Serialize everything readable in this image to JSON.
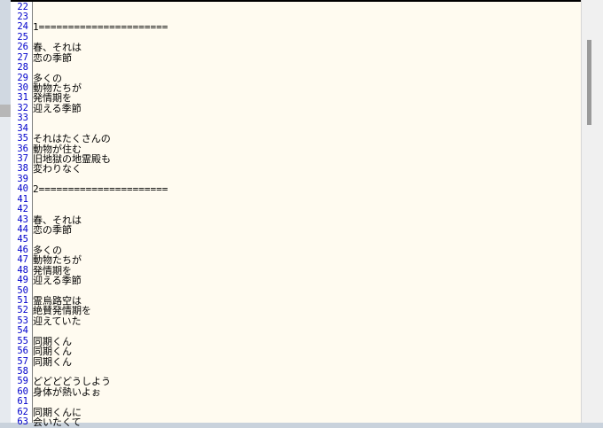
{
  "editor": {
    "lines": [
      {
        "num": "22",
        "text": ""
      },
      {
        "num": "23",
        "text": ""
      },
      {
        "num": "24",
        "text": "1======================"
      },
      {
        "num": "25",
        "text": ""
      },
      {
        "num": "26",
        "text": "春、それは"
      },
      {
        "num": "27",
        "text": "恋の季節"
      },
      {
        "num": "28",
        "text": ""
      },
      {
        "num": "29",
        "text": "多くの"
      },
      {
        "num": "30",
        "text": "動物たちが"
      },
      {
        "num": "31",
        "text": "発情期を"
      },
      {
        "num": "32",
        "text": "迎える季節"
      },
      {
        "num": "33",
        "text": ""
      },
      {
        "num": "34",
        "text": ""
      },
      {
        "num": "35",
        "text": "それはたくさんの"
      },
      {
        "num": "36",
        "text": "動物が住む"
      },
      {
        "num": "37",
        "text": "旧地獄の地霊殿も"
      },
      {
        "num": "38",
        "text": "変わりなく"
      },
      {
        "num": "39",
        "text": ""
      },
      {
        "num": "40",
        "text": "2======================"
      },
      {
        "num": "41",
        "text": ""
      },
      {
        "num": "42",
        "text": ""
      },
      {
        "num": "43",
        "text": "春、それは"
      },
      {
        "num": "44",
        "text": "恋の季節"
      },
      {
        "num": "45",
        "text": ""
      },
      {
        "num": "46",
        "text": "多くの"
      },
      {
        "num": "47",
        "text": "動物たちが"
      },
      {
        "num": "48",
        "text": "発情期を"
      },
      {
        "num": "49",
        "text": "迎える季節"
      },
      {
        "num": "50",
        "text": ""
      },
      {
        "num": "51",
        "text": "霊烏路空は"
      },
      {
        "num": "52",
        "text": "絶賛発情期を"
      },
      {
        "num": "53",
        "text": "迎えていた"
      },
      {
        "num": "54",
        "text": ""
      },
      {
        "num": "55",
        "text": "同期くん"
      },
      {
        "num": "56",
        "text": "同期くん"
      },
      {
        "num": "57",
        "text": "同期くん"
      },
      {
        "num": "58",
        "text": ""
      },
      {
        "num": "59",
        "text": "どどどどうしよう"
      },
      {
        "num": "60",
        "text": "身体が熱いよぉ"
      },
      {
        "num": "61",
        "text": ""
      },
      {
        "num": "62",
        "text": "同期くんに"
      },
      {
        "num": "63",
        "text": "会いたくて"
      }
    ]
  },
  "colors": {
    "editor_background": "#fffbf0",
    "line_number": "#0000cc",
    "text": "#000000"
  }
}
